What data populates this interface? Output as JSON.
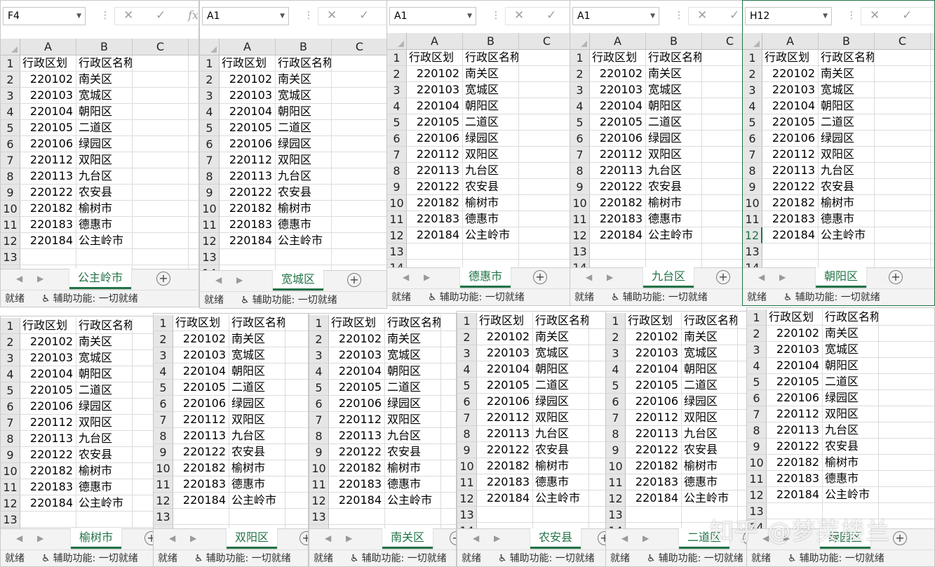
{
  "rows": [
    {
      "code": "行政区划",
      "name": "行政区名称"
    },
    {
      "code": "220102",
      "name": "南关区"
    },
    {
      "code": "220103",
      "name": "宽城区"
    },
    {
      "code": "220104",
      "name": "朝阳区"
    },
    {
      "code": "220105",
      "name": "二道区"
    },
    {
      "code": "220106",
      "name": "绿园区"
    },
    {
      "code": "220112",
      "name": "双阳区"
    },
    {
      "code": "220113",
      "name": "九台区"
    },
    {
      "code": "220122",
      "name": "农安县"
    },
    {
      "code": "220182",
      "name": "榆树市"
    },
    {
      "code": "220183",
      "name": "德惠市"
    },
    {
      "code": "220184",
      "name": "公主岭市"
    },
    {
      "code": "",
      "name": ""
    },
    {
      "code": "",
      "name": ""
    }
  ],
  "row_numbers": [
    "1",
    "2",
    "3",
    "4",
    "5",
    "6",
    "7",
    "8",
    "9",
    "10",
    "11",
    "12",
    "13",
    "14"
  ],
  "columns": [
    "A",
    "B",
    "C"
  ],
  "status_ready": "就绪",
  "status_accessibility": "辅助功能: 一切就绪",
  "cancel_glyph": "✕",
  "confirm_glyph": "✓",
  "fx_glyph": "fx",
  "plus_glyph": "+",
  "watermark": "知乎 @梦荚楼兰",
  "accent_color": "#217346",
  "windows": [
    {
      "name_box": "F4",
      "sheet_tab": "公主岭市"
    },
    {
      "name_box": "A1",
      "sheet_tab": "宽城区"
    },
    {
      "name_box": "A1",
      "sheet_tab": "德惠市"
    },
    {
      "name_box": "A1",
      "sheet_tab": "九台区"
    },
    {
      "name_box": "H12",
      "sheet_tab": "朝阳区"
    },
    {
      "name_box": "",
      "sheet_tab": "榆树市"
    },
    {
      "name_box": "",
      "sheet_tab": "双阳区"
    },
    {
      "name_box": "",
      "sheet_tab": "南关区"
    },
    {
      "name_box": "",
      "sheet_tab": "农安县"
    },
    {
      "name_box": "",
      "sheet_tab": "二道区"
    },
    {
      "name_box": "",
      "sheet_tab": "绿园区"
    }
  ]
}
